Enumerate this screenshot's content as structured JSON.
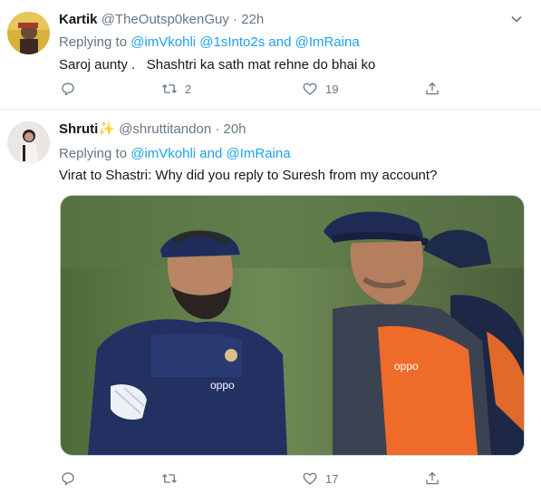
{
  "tweets": [
    {
      "name": "Kartik",
      "handle": "@TheOutsp0kenGuy",
      "separator": "·",
      "time": "22h",
      "reply_prefix": "Replying to",
      "reply_to": "@imVkohli @1sInto2s and @ImRaina",
      "text": "Saroj aunty .   Shashtri ka sath mat rehne do bhai ko",
      "retweets": "2",
      "likes": "19",
      "icons": [
        "reply-icon",
        "retweet-icon",
        "like-icon",
        "share-icon",
        "chevron-down-icon"
      ]
    },
    {
      "name": "Shruti",
      "name_emoji": "✨",
      "handle": "@shruttitandon",
      "separator": "·",
      "time": "20h",
      "reply_prefix": "Replying to",
      "reply_to": "@imVkohli and @ImRaina",
      "text": "Virat to Shastri: Why did you reply to Suresh from my account?",
      "image_brand_text": "oppo",
      "likes": "17",
      "icons": [
        "reply-icon",
        "retweet-icon",
        "like-icon",
        "share-icon"
      ]
    }
  ],
  "colors": {
    "link": "#1da1f2",
    "muted": "#657786",
    "text": "#14171a",
    "divider": "#e6ecf0"
  }
}
